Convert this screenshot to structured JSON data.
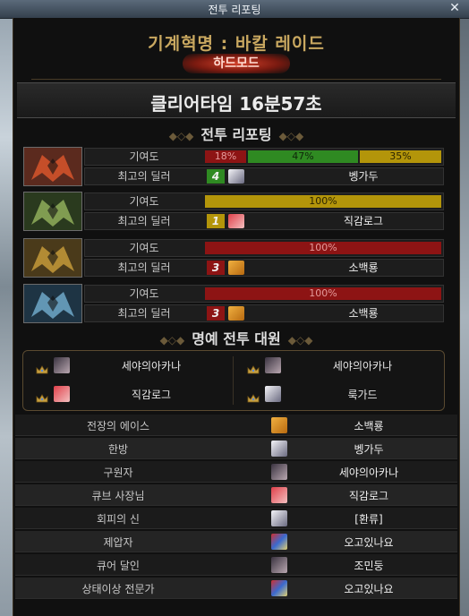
{
  "window": {
    "title": "전투 리포팅"
  },
  "raid": {
    "title": "기계혁명 : 바칼 레이드",
    "difficulty": "하드모드"
  },
  "clear": {
    "label": "클리어타임 16분57초"
  },
  "report_heading": "전투 리포팅",
  "labels": {
    "contribution": "기여도",
    "best_dealer": "최고의 딜러"
  },
  "bosses": [
    {
      "colors": {
        "bg": "#5b2a1e",
        "accent": "#d8552b"
      },
      "contribution": [
        {
          "text": "18%",
          "pct": 18,
          "color": "red"
        },
        {
          "text": "47%",
          "pct": 47,
          "color": "green"
        },
        {
          "text": "35%",
          "pct": 35,
          "color": "gold"
        }
      ],
      "best": {
        "rank": "4",
        "color": "#2f8a22",
        "name": "벵가두"
      }
    },
    {
      "colors": {
        "bg": "#2a3a1e",
        "accent": "#8fae5a"
      },
      "contribution": [
        {
          "text": "100%",
          "pct": 100,
          "color": "gold"
        }
      ],
      "best": {
        "rank": "1",
        "color": "#b3950a",
        "name": "직감로그"
      }
    },
    {
      "colors": {
        "bg": "#4a3a1a",
        "accent": "#c49a3a"
      },
      "contribution": [
        {
          "text": "100%",
          "pct": 100,
          "color": "red"
        }
      ],
      "best": {
        "rank": "3",
        "color": "#8d1414",
        "name": "소백룡"
      }
    },
    {
      "colors": {
        "bg": "#1e3444",
        "accent": "#6fa8c8"
      },
      "contribution": [
        {
          "text": "100%",
          "pct": 100,
          "color": "red"
        }
      ],
      "best": {
        "rank": "3",
        "color": "#8d1414",
        "name": "소백룡"
      }
    }
  ],
  "honor_heading": "명예 전투 대원",
  "honor": [
    "세야의아카나",
    "세야의아카나",
    "직감로그",
    "룩가드"
  ],
  "awards": [
    {
      "title": "전장의 에이스",
      "name": "소백룡",
      "icon": "box-avatar"
    },
    {
      "title": "한방",
      "name": "벵가두",
      "icon": "white-hair-avatar"
    },
    {
      "title": "구원자",
      "name": "세야의아카나",
      "icon": "dark-hair-avatar"
    },
    {
      "title": "큐브 사장님",
      "name": "직감로그",
      "icon": "red-hair-avatar"
    },
    {
      "title": "회피의 신",
      "name": "[환류]",
      "icon": "white-hair-avatar"
    },
    {
      "title": "제압자",
      "name": "오고있나요",
      "icon": "multi-color-avatar"
    },
    {
      "title": "큐어 달인",
      "name": "조민둥",
      "icon": "dark-hair-avatar"
    },
    {
      "title": "상태이상 전문가",
      "name": "오고있나요",
      "icon": "multi-color-avatar"
    }
  ]
}
